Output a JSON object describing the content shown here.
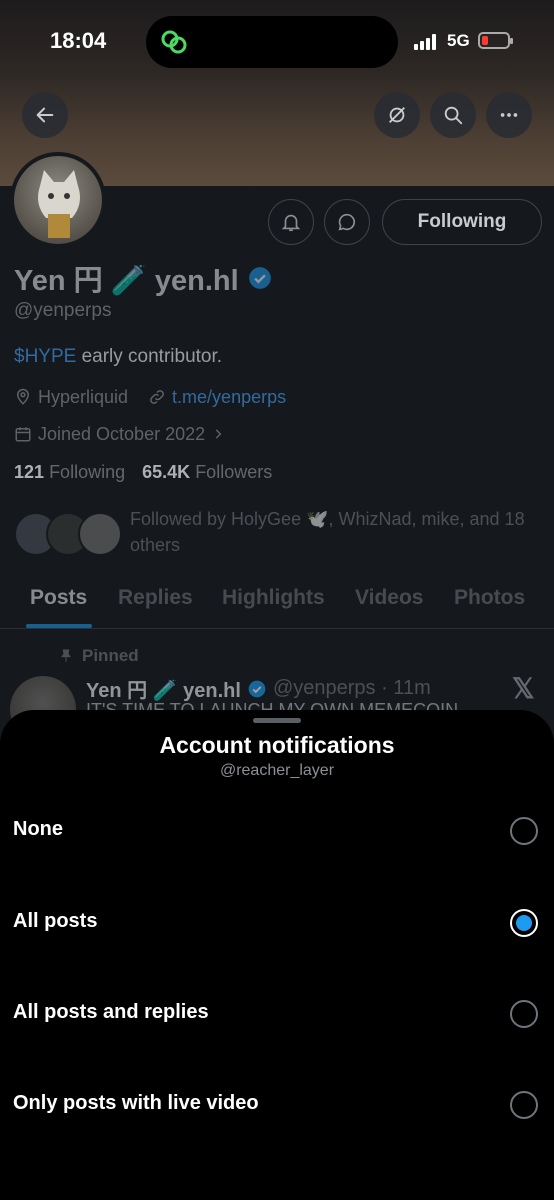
{
  "status_bar": {
    "time": "18:04",
    "network": "5G"
  },
  "profile": {
    "name": "Yen 円 🧪 yen.hl",
    "handle": "@yenperps",
    "bio_cashtag": "$HYPE",
    "bio_rest": " early contributor.",
    "location": "Hyperliquid",
    "website": "t.me/yenperps",
    "joined": "Joined October 2022",
    "following_count": "121",
    "following_label": "Following",
    "followers_count": "65.4K",
    "followers_label": "Followers",
    "followed_by": "Followed by HolyGee 🕊️, WhizNad, mike, and 18 others",
    "follow_button": "Following"
  },
  "tabs": [
    "Posts",
    "Replies",
    "Highlights",
    "Videos",
    "Photos"
  ],
  "active_tab": "Posts",
  "pinned_post": {
    "pinned_label": "Pinned",
    "author": "Yen 円 🧪 yen.hl",
    "handle_time": "@yenperps · 11m",
    "text": "IT'S TIME TO LAUNCH MY OWN MEMECOIN"
  },
  "sheet": {
    "title": "Account notifications",
    "subtitle": "@reacher_layer",
    "options": [
      {
        "label": "None",
        "selected": false
      },
      {
        "label": "All posts",
        "selected": true
      },
      {
        "label": "All posts and replies",
        "selected": false
      },
      {
        "label": "Only posts with live video",
        "selected": false
      }
    ]
  },
  "colors": {
    "accent": "#1d9bf0",
    "verified": "#1d9bf0",
    "battery_low": "#ff3b30"
  }
}
